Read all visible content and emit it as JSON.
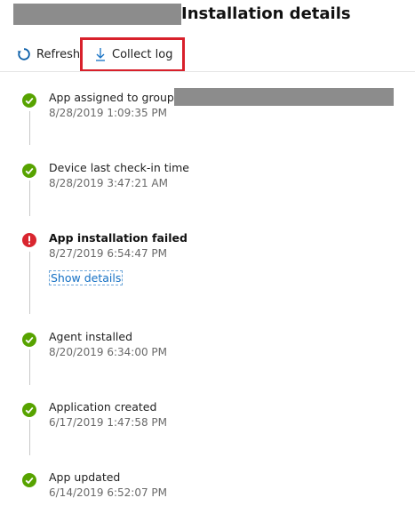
{
  "header": {
    "title": "Installation details"
  },
  "toolbar": {
    "refresh_label": "Refresh",
    "collect_log_label": "Collect log"
  },
  "events": [
    {
      "title": "App assigned to group",
      "time": "8/28/2019 1:09:35 PM",
      "status": "success"
    },
    {
      "title": "Device last check-in time",
      "time": "8/28/2019 3:47:21 AM",
      "status": "success"
    },
    {
      "title": "App installation failed",
      "time": "8/27/2019 6:54:47 PM",
      "status": "error",
      "link": "Show details"
    },
    {
      "title": "Agent installed",
      "time": "8/20/2019 6:34:00 PM",
      "status": "success"
    },
    {
      "title": "Application created",
      "time": "6/17/2019 1:47:58 PM",
      "status": "success"
    },
    {
      "title": "App updated",
      "time": "6/14/2019 6:52:07 PM",
      "status": "success"
    }
  ],
  "colors": {
    "success": "#57a300",
    "error": "#d9262f",
    "link": "#1470c4",
    "highlight": "#d8202b",
    "refresh_icon": "#0a5ea8"
  }
}
